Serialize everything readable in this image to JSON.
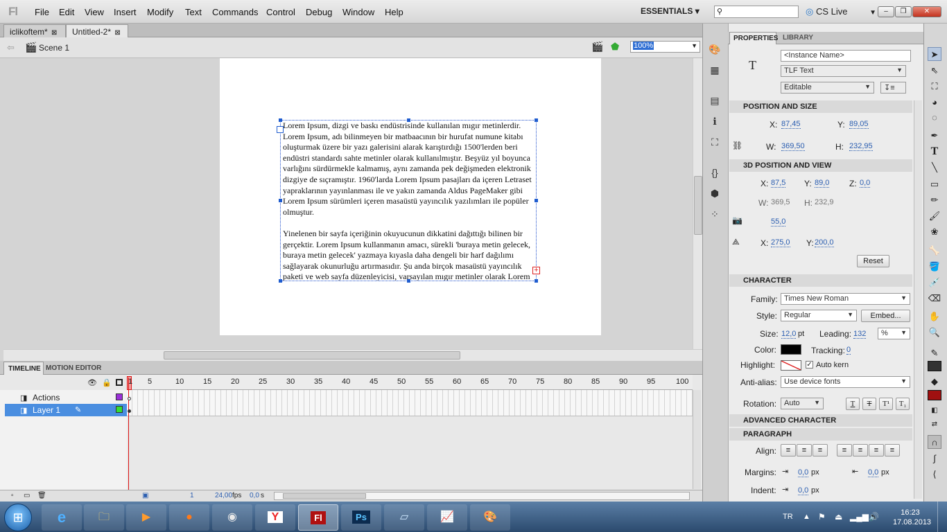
{
  "app": {
    "logo": "Fl"
  },
  "menu": [
    "File",
    "Edit",
    "View",
    "Insert",
    "Modify",
    "Text",
    "Commands",
    "Control",
    "Debug",
    "Window",
    "Help"
  ],
  "workspace": {
    "label": "ESSENTIALS",
    "cs_live": "CS Live"
  },
  "doc_tabs": [
    "iclikoftem*",
    "Untitled-2*"
  ],
  "scene": {
    "label": "Scene 1",
    "zoom": "100%"
  },
  "textbox": {
    "paragraph1": "Lorem Ipsum, dizgi ve baskı endüstrisinde kullanılan mıgır metinlerdir. Lorem Ipsum, adı bilinmeyen bir matbaacının bir hurufat numune kitabı oluşturmak üzere bir yazı galerisini alarak karıştırdığı 1500'lerden beri endüstri standardı sahte metinler olarak kullanılmıştır. Beşyüz yıl boyunca varlığını sürdürmekle kalmamış, aynı zamanda pek değişmeden elektronik dizgiye de sıçramıştır. 1960'larda Lorem Ipsum pasajları da içeren Letraset yapraklarının yayınlanması ile ve yakın zamanda Aldus PageMaker gibi Lorem Ipsum sürümleri içeren masaüstü yayıncılık yazılımları ile popüler olmuştur.",
    "paragraph2": "Yinelenen bir sayfa içeriğinin okuyucunun dikkatini dağıttığı bilinen bir gerçektir. Lorem Ipsum kullanmanın amacı, sürekli 'buraya metin gelecek, buraya metin gelecek' yazmaya kıyasla daha dengeli bir harf dağılımı sağlayarak okunurluğu artırmasıdır. Şu anda birçok masaüstü yayıncılık paketi ve web sayfa düzenleyicisi, varsayılan mıgır metinler olarak Lorem"
  },
  "timeline": {
    "tabs": [
      "TIMELINE",
      "MOTION EDITOR"
    ],
    "frame_numbers": [
      "1",
      "5",
      "10",
      "15",
      "20",
      "25",
      "30",
      "35",
      "40",
      "45",
      "50",
      "55",
      "60",
      "65",
      "70",
      "75",
      "80",
      "85",
      "90",
      "95",
      "100"
    ],
    "layers": [
      {
        "name": "Actions",
        "color": "#9b30d9"
      },
      {
        "name": "Layer 1",
        "color": "#33dd33"
      }
    ],
    "status": {
      "frame": "1",
      "fps": "24,00",
      "fps_unit": "fps",
      "time": "0,0",
      "time_unit": "s"
    }
  },
  "properties": {
    "tabs": [
      "PROPERTIES",
      "LIBRARY"
    ],
    "instance_placeholder": "<Instance Name>",
    "text_type": "TLF Text",
    "editable": "Editable",
    "position_size": {
      "header": "POSITION AND SIZE",
      "x_label": "X:",
      "x": "87,45",
      "y_label": "Y:",
      "y": "89,05",
      "w_label": "W:",
      "w": "369,50",
      "h_label": "H:",
      "h": "232,95"
    },
    "pos3d": {
      "header": "3D POSITION AND VIEW",
      "x_label": "X:",
      "x": "87,5",
      "y_label": "Y:",
      "y": "89,0",
      "z_label": "Z:",
      "z": "0,0",
      "w_label": "W:",
      "w": "369,5",
      "h_label": "H:",
      "h": "232,9",
      "perspective": "55,0",
      "vp_x_label": "X:",
      "vp_x": "275,0",
      "vp_y_label": "Y:",
      "vp_y": "200,0",
      "reset": "Reset"
    },
    "character": {
      "header": "CHARACTER",
      "family_label": "Family:",
      "family": "Times New Roman",
      "style_label": "Style:",
      "style": "Regular",
      "embed": "Embed...",
      "size_label": "Size:",
      "size": "12,0",
      "size_unit": "pt",
      "leading_label": "Leading:",
      "leading": "132",
      "leading_unit": "%",
      "color_label": "Color:",
      "color": "#000000",
      "tracking_label": "Tracking:",
      "tracking": "0",
      "highlight_label": "Highlight:",
      "autokern": "Auto kern",
      "antialias_label": "Anti-alias:",
      "antialias": "Use device fonts",
      "rotation_label": "Rotation:",
      "rotation": "Auto"
    },
    "advanced": {
      "header": "ADVANCED CHARACTER"
    },
    "paragraph": {
      "header": "PARAGRAPH",
      "align_label": "Align:",
      "margins_label": "Margins:",
      "margin_left": "0,0",
      "margin_right": "0,0",
      "unit": "px",
      "indent_label": "Indent:",
      "indent": "0,0"
    }
  },
  "taskbar": {
    "language": "TR",
    "time": "16:23",
    "date": "17.08.2013"
  }
}
